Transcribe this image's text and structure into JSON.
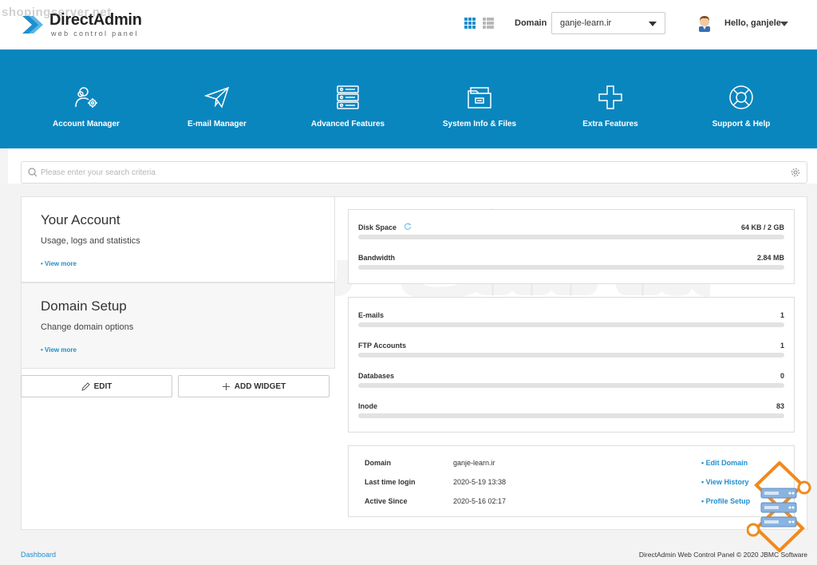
{
  "header": {
    "watermark_text": "shopingserver.net",
    "logo_title": "DirectAdmin",
    "logo_subtitle": "web control panel",
    "domain_label": "Domain",
    "domain_selected": "ganje-learn.ir",
    "greeting": "Hello, ganjele"
  },
  "nav": {
    "items": [
      {
        "label": "Account Manager",
        "icon": "users-gear-icon"
      },
      {
        "label": "E-mail Manager",
        "icon": "paper-plane-icon"
      },
      {
        "label": "Advanced Features",
        "icon": "database-icon"
      },
      {
        "label": "System Info & Files",
        "icon": "folder-icon"
      },
      {
        "label": "Extra Features",
        "icon": "plus-icon"
      },
      {
        "label": "Support & Help",
        "icon": "lifebuoy-icon"
      }
    ]
  },
  "search": {
    "placeholder": "Please enter your search criteria"
  },
  "cards": {
    "account": {
      "title": "Your Account",
      "subtitle": "Usage, logs and statistics",
      "more": "• View more"
    },
    "domain": {
      "title": "Domain Setup",
      "subtitle": "Change domain options",
      "more": "• View more"
    }
  },
  "buttons": {
    "edit": "EDIT",
    "add_widget": "ADD WIDGET"
  },
  "usage": {
    "disk": {
      "name": "Disk Space",
      "value": "64 KB / 2 GB",
      "fill": 0.0
    },
    "bandwidth": {
      "name": "Bandwidth",
      "value": "2.84 MB",
      "fill": 0.0
    }
  },
  "counts": {
    "emails": {
      "name": "E-mails",
      "value": "1",
      "fill": 0.0
    },
    "ftp": {
      "name": "FTP Accounts",
      "value": "1",
      "fill": 0.0
    },
    "databases": {
      "name": "Databases",
      "value": "0",
      "fill": 0.0
    },
    "inode": {
      "name": "Inode",
      "value": "83",
      "fill": 0.0
    }
  },
  "info": {
    "domain_key": "Domain",
    "domain_val": "ganje-learn.ir",
    "domain_action": "• Edit Domain",
    "login_key": "Last time login",
    "login_val": "2020-5-19 13:38",
    "login_action": "• View History",
    "since_key": "Active Since",
    "since_val": "2020-5-16 02:17",
    "since_action": "• Profile Setup"
  },
  "footer": {
    "breadcrumb": "Dashboard",
    "copyright": "DirectAdmin Web Control Panel © 2020 JBMC Software"
  },
  "colors": {
    "brand": "#0a86bf",
    "link": "#1f8fcd",
    "accent_orange": "#f08a1c"
  }
}
